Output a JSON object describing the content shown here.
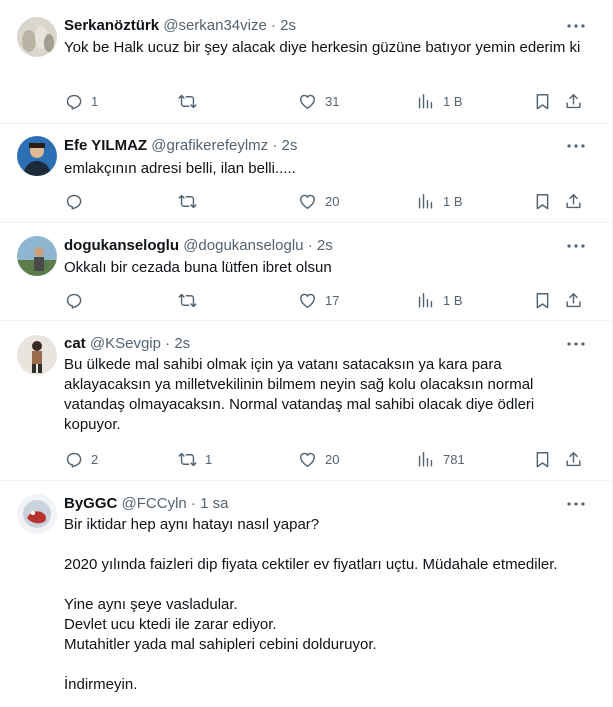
{
  "tweets": [
    {
      "name": "Serkanöztürk",
      "handle": "@serkan34vize",
      "time": "2s",
      "text": [
        "Yok be Halk ucuz bir şey alacak diye herkesin güzüne batıyor yemin ederim ki"
      ],
      "replies": "1",
      "retweets": "",
      "likes": "31",
      "views": "1 B"
    },
    {
      "name": "Efe YILMAZ",
      "handle": "@grafikerefeylmz",
      "time": "2s",
      "text": [
        "emlakçının adresi belli, ilan belli....."
      ],
      "replies": "",
      "retweets": "",
      "likes": "20",
      "views": "1 B"
    },
    {
      "name": "dogukanseloglu",
      "handle": "@dogukanseloglu",
      "time": "2s",
      "text": [
        "Okkalı bir cezada buna lütfen ibret olsun"
      ],
      "replies": "",
      "retweets": "",
      "likes": "17",
      "views": "1 B"
    },
    {
      "name": "cat",
      "handle": "@KSevgip",
      "time": "2s",
      "text": [
        "Bu ülkede mal sahibi olmak için ya vatanı satacaksın ya kara para aklayacaksın ya milletvekilinin bilmem neyin sağ kolu olacaksın normal vatandaş olmayacaksın. Normal vatandaş mal sahibi olacak diye ödleri kopuyor."
      ],
      "replies": "2",
      "retweets": "1",
      "likes": "20",
      "views": "781"
    },
    {
      "name": "ByGGC",
      "handle": "@FCCyln",
      "time": "1 sa",
      "text": [
        "Bir iktidar hep aynı hatayı nasıl yapar?",
        "",
        "2020 yılında faizleri dip fiyata cektiler ev fiyatları uçtu. Müdahale etmediler.",
        "",
        "Yine aynı şeye vasladular.",
        "Devlet ucu ktedi ile zarar ediyor.",
        "Mutahitler yada mal sahipleri cebini dolduruyor.",
        "",
        "İndirmeyin."
      ]
    }
  ],
  "separator": "·",
  "icons": {
    "more": "more-dots-icon",
    "reply": "reply-icon",
    "retweet": "retweet-icon",
    "like": "heart-icon",
    "views": "views-chart-icon",
    "bookmark": "bookmark-icon",
    "share": "share-icon"
  },
  "colors": {
    "text": "#0f1419",
    "secondary": "#536471",
    "divider": "#eff3f4"
  }
}
